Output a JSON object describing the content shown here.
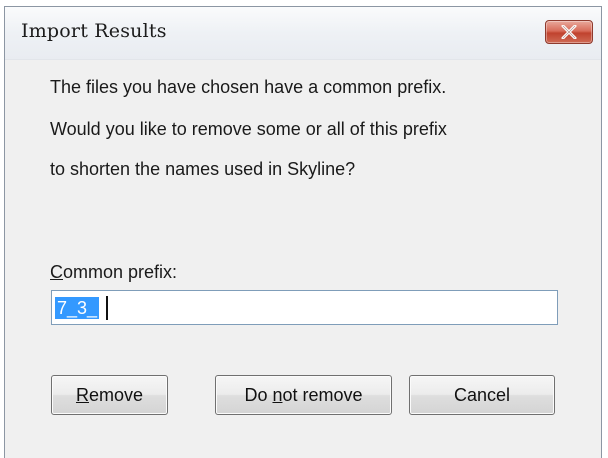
{
  "dialog": {
    "title": "Import Results",
    "message_lines": [
      "The files you have chosen have a common prefix.",
      "Would you like to remove some or all of this prefix",
      "to shorten the names used in Skyline?"
    ],
    "prefix_label_underlined": "C",
    "prefix_label_rest": "ommon prefix:",
    "prefix_value": "7_3_",
    "buttons": {
      "remove": {
        "underlined": "R",
        "rest": "emove"
      },
      "do_not_remove": {
        "before": "Do ",
        "underlined": "n",
        "after": "ot remove"
      },
      "cancel": {
        "label": "Cancel"
      }
    },
    "close_icon": "close-x-icon",
    "colors": {
      "close_button": "#c0432e",
      "selection": "#3399ff",
      "window_bg": "#f0f0f0"
    }
  }
}
